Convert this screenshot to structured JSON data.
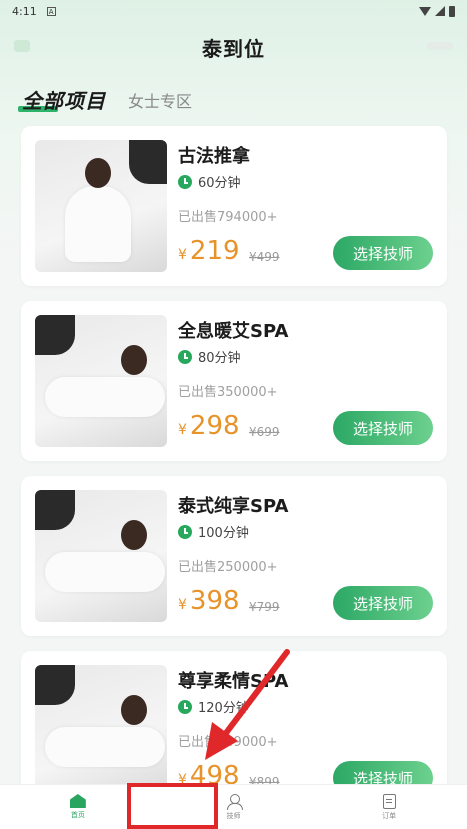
{
  "status": {
    "time": "4:11",
    "notif": "A"
  },
  "header": {
    "title": "泰到位"
  },
  "tabs": [
    {
      "label": "全部项目"
    },
    {
      "label": "女士专区"
    }
  ],
  "services": [
    {
      "name": "古法推拿",
      "duration": "60分钟",
      "sold": "已出售794000+",
      "currency": "¥",
      "price": "219",
      "original_price": "¥499",
      "button": "选择技师"
    },
    {
      "name": "全息暖艾SPA",
      "duration": "80分钟",
      "sold": "已出售350000+",
      "currency": "¥",
      "price": "298",
      "original_price": "¥699",
      "button": "选择技师"
    },
    {
      "name": "泰式纯享SPA",
      "duration": "100分钟",
      "sold": "已出售250000+",
      "currency": "¥",
      "price": "398",
      "original_price": "¥799",
      "button": "选择技师"
    },
    {
      "name": "尊享柔情SPA",
      "duration": "120分钟",
      "sold": "已出售149000+",
      "currency": "¥",
      "price": "498",
      "original_price": "¥899",
      "button": "选择技师"
    }
  ],
  "nav": [
    {
      "label": "首页",
      "icon": "home-icon"
    },
    {
      "label": "技师",
      "icon": "person-icon"
    },
    {
      "label": "订单",
      "icon": "order-icon"
    }
  ],
  "colors": {
    "accent": "#2aa560",
    "price": "#e8932a",
    "annotation": "#e0282b"
  }
}
